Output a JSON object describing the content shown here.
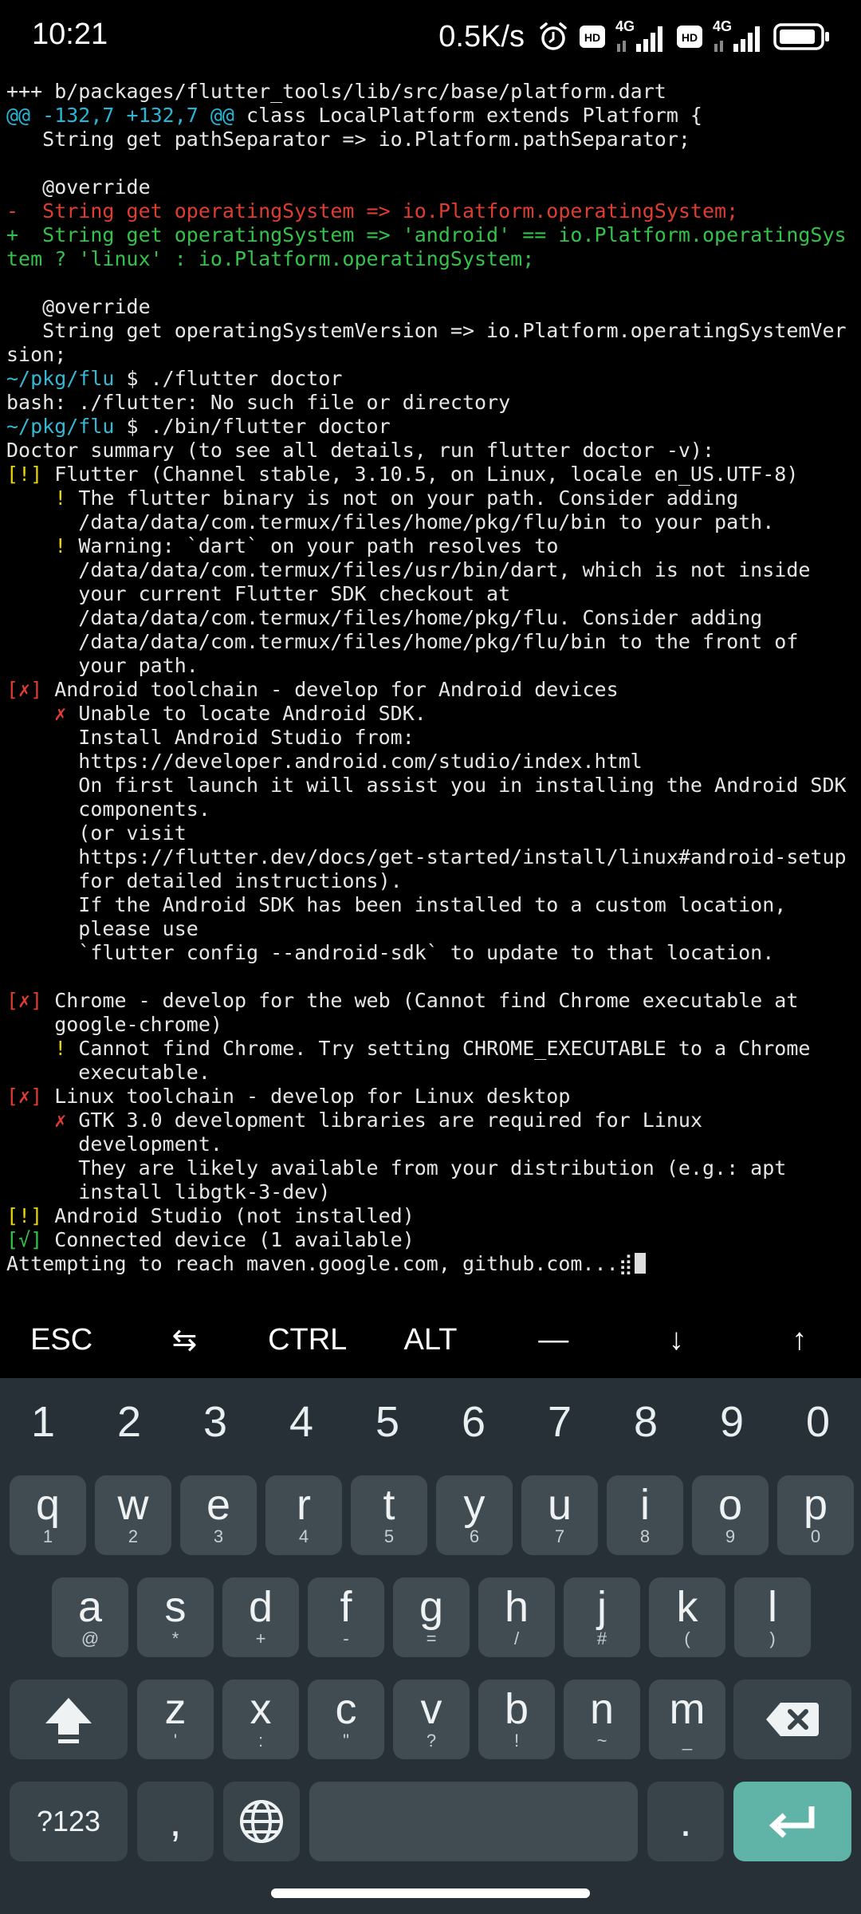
{
  "status_bar": {
    "time": "10:21",
    "net_speed": "0.5K/s",
    "hd1": "HD",
    "net1": "4G",
    "hd2": "HD",
    "net2": "4G"
  },
  "terminal": {
    "lines": [
      [
        {
          "t": "+++ b/packages/flutter_tools/lib/src/base/platform.dart",
          "c": ""
        }
      ],
      [
        {
          "t": "@@ -132,7 +132,7 @@",
          "c": "hunk"
        },
        {
          "t": " class LocalPlatform extends Platform {",
          "c": ""
        }
      ],
      [
        {
          "t": "   String get pathSeparator => io.Platform.pathSeparator;",
          "c": ""
        }
      ],
      [
        {
          "t": "",
          "c": ""
        }
      ],
      [
        {
          "t": "   @override",
          "c": ""
        }
      ],
      [
        {
          "t": "-  String get operatingSystem => io.Platform.operatingSystem;",
          "c": "del"
        }
      ],
      [
        {
          "t": "+  String get operatingSystem => 'android' == io.Platform.operatingSys",
          "c": "add"
        }
      ],
      [
        {
          "t": "tem ? 'linux' : io.Platform.operatingSystem;",
          "c": "add"
        }
      ],
      [
        {
          "t": "",
          "c": ""
        }
      ],
      [
        {
          "t": "   @override",
          "c": ""
        }
      ],
      [
        {
          "t": "   String get operatingSystemVersion => io.Platform.operatingSystemVer",
          "c": ""
        }
      ],
      [
        {
          "t": "sion;",
          "c": ""
        }
      ],
      [
        {
          "t": "~/pkg/flu",
          "c": "path"
        },
        {
          "t": " $ ./flutter doctor",
          "c": ""
        }
      ],
      [
        {
          "t": "bash: ./flutter: No such file or directory",
          "c": ""
        }
      ],
      [
        {
          "t": "~/pkg/flu",
          "c": "path"
        },
        {
          "t": " $ ./bin/flutter doctor",
          "c": ""
        }
      ],
      [
        {
          "t": "Doctor summary (to see all details, run flutter doctor -v):",
          "c": ""
        }
      ],
      [
        {
          "t": "[!]",
          "c": "warn"
        },
        {
          "t": " Flutter (Channel stable, 3.10.5, on Linux, locale en_US.UTF-8)",
          "c": ""
        }
      ],
      [
        {
          "t": "    ",
          "c": ""
        },
        {
          "t": "!",
          "c": "warn"
        },
        {
          "t": " The flutter binary is not on your path. Consider adding",
          "c": ""
        }
      ],
      [
        {
          "t": "      /data/data/com.termux/files/home/pkg/flu/bin to your path.",
          "c": ""
        }
      ],
      [
        {
          "t": "    ",
          "c": ""
        },
        {
          "t": "!",
          "c": "warn"
        },
        {
          "t": " Warning: `dart` on your path resolves to",
          "c": ""
        }
      ],
      [
        {
          "t": "      /data/data/com.termux/files/usr/bin/dart, which is not inside",
          "c": ""
        }
      ],
      [
        {
          "t": "      your current Flutter SDK checkout at",
          "c": ""
        }
      ],
      [
        {
          "t": "      /data/data/com.termux/files/home/pkg/flu. Consider adding",
          "c": ""
        }
      ],
      [
        {
          "t": "      /data/data/com.termux/files/home/pkg/flu/bin to the front of",
          "c": ""
        }
      ],
      [
        {
          "t": "      your path.",
          "c": ""
        }
      ],
      [
        {
          "t": "[✗]",
          "c": "err"
        },
        {
          "t": " Android toolchain - develop for Android devices",
          "c": ""
        }
      ],
      [
        {
          "t": "    ",
          "c": ""
        },
        {
          "t": "✗",
          "c": "err"
        },
        {
          "t": " Unable to locate Android SDK.",
          "c": ""
        }
      ],
      [
        {
          "t": "      Install Android Studio from:",
          "c": ""
        }
      ],
      [
        {
          "t": "      https://developer.android.com/studio/index.html",
          "c": ""
        }
      ],
      [
        {
          "t": "      On first launch it will assist you in installing the Android SDK",
          "c": ""
        }
      ],
      [
        {
          "t": "      components.",
          "c": ""
        }
      ],
      [
        {
          "t": "      (or visit",
          "c": ""
        }
      ],
      [
        {
          "t": "      https://flutter.dev/docs/get-started/install/linux#android-setup",
          "c": ""
        }
      ],
      [
        {
          "t": "      for detailed instructions).",
          "c": ""
        }
      ],
      [
        {
          "t": "      If the Android SDK has been installed to a custom location,",
          "c": ""
        }
      ],
      [
        {
          "t": "      please use",
          "c": ""
        }
      ],
      [
        {
          "t": "      `flutter config --android-sdk` to update to that location.",
          "c": ""
        }
      ],
      [
        {
          "t": "",
          "c": ""
        }
      ],
      [
        {
          "t": "[✗]",
          "c": "err"
        },
        {
          "t": " Chrome - develop for the web (Cannot find Chrome executable at",
          "c": ""
        }
      ],
      [
        {
          "t": "    google-chrome)",
          "c": ""
        }
      ],
      [
        {
          "t": "    ",
          "c": ""
        },
        {
          "t": "!",
          "c": "warn"
        },
        {
          "t": " Cannot find Chrome. Try setting CHROME_EXECUTABLE to a Chrome",
          "c": ""
        }
      ],
      [
        {
          "t": "      executable.",
          "c": ""
        }
      ],
      [
        {
          "t": "[✗]",
          "c": "err"
        },
        {
          "t": " Linux toolchain - develop for Linux desktop",
          "c": ""
        }
      ],
      [
        {
          "t": "    ",
          "c": ""
        },
        {
          "t": "✗",
          "c": "err"
        },
        {
          "t": " GTK 3.0 development libraries are required for Linux",
          "c": ""
        }
      ],
      [
        {
          "t": "      development.",
          "c": ""
        }
      ],
      [
        {
          "t": "      They are likely available from your distribution (e.g.: apt",
          "c": ""
        }
      ],
      [
        {
          "t": "      install libgtk-3-dev)",
          "c": ""
        }
      ],
      [
        {
          "t": "[!]",
          "c": "warn"
        },
        {
          "t": " Android Studio (not installed)",
          "c": ""
        }
      ],
      [
        {
          "t": "[√]",
          "c": "ok"
        },
        {
          "t": " Connected device (1 available)",
          "c": ""
        }
      ],
      [
        {
          "t": "Attempting to reach maven.google.com, github.com...⣾",
          "c": ""
        }
      ]
    ]
  },
  "extra_keys": {
    "esc": "ESC",
    "tab": "⇆",
    "ctrl": "CTRL",
    "alt": "ALT",
    "dash": "—",
    "down": "↓",
    "up": "↑"
  },
  "keyboard": {
    "numbers": [
      "1",
      "2",
      "3",
      "4",
      "5",
      "6",
      "7",
      "8",
      "9",
      "0"
    ],
    "row1": [
      {
        "k": "q",
        "s": "1"
      },
      {
        "k": "w",
        "s": "2"
      },
      {
        "k": "e",
        "s": "3"
      },
      {
        "k": "r",
        "s": "4"
      },
      {
        "k": "t",
        "s": "5"
      },
      {
        "k": "y",
        "s": "6"
      },
      {
        "k": "u",
        "s": "7"
      },
      {
        "k": "i",
        "s": "8"
      },
      {
        "k": "o",
        "s": "9"
      },
      {
        "k": "p",
        "s": "0"
      }
    ],
    "row2": [
      {
        "k": "a",
        "s": "@"
      },
      {
        "k": "s",
        "s": "*"
      },
      {
        "k": "d",
        "s": "+"
      },
      {
        "k": "f",
        "s": "-"
      },
      {
        "k": "g",
        "s": "="
      },
      {
        "k": "h",
        "s": "/"
      },
      {
        "k": "j",
        "s": "#"
      },
      {
        "k": "k",
        "s": "("
      },
      {
        "k": "l",
        "s": ")"
      }
    ],
    "row3": [
      {
        "k": "z",
        "s": "'"
      },
      {
        "k": "x",
        "s": ":"
      },
      {
        "k": "c",
        "s": "\""
      },
      {
        "k": "v",
        "s": "?"
      },
      {
        "k": "b",
        "s": "!"
      },
      {
        "k": "n",
        "s": "~"
      },
      {
        "k": "m",
        "s": "_"
      }
    ],
    "symbols_label": "?123",
    "comma": ",",
    "period": "."
  },
  "colors": {
    "background": "#000000",
    "keyboard_bg": "#263036",
    "key_bg": "#404b52",
    "enter_bg": "#5fb3a7",
    "diff_removed": "#e03c31",
    "diff_added": "#33c34b",
    "hunk_header": "#27b6d8",
    "warning": "#e8d40c"
  }
}
